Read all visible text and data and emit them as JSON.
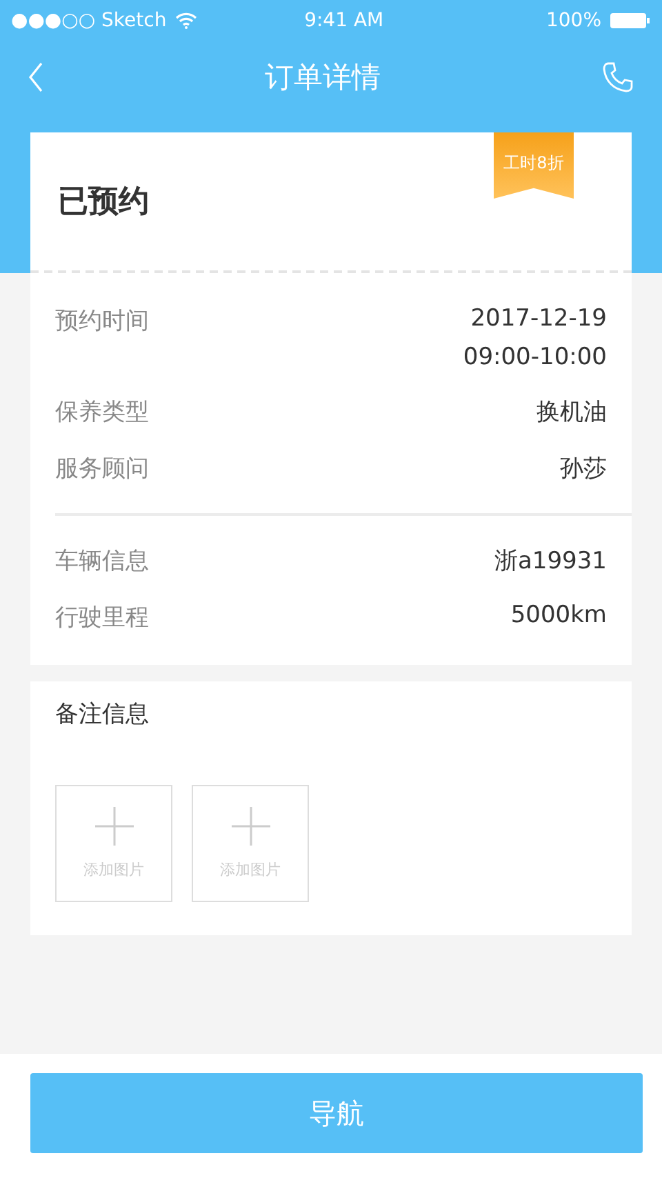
{
  "status_bar": {
    "carrier": "●●●○○ Sketch",
    "time": "9:41 AM",
    "battery": "100%"
  },
  "nav": {
    "title": "订单详情"
  },
  "order": {
    "status": "已预约",
    "ribbon": "工时8折"
  },
  "details": [
    {
      "label": "预约时间",
      "value_lines": [
        "2017-12-19",
        "09:00-10:00"
      ]
    },
    {
      "label": "保养类型",
      "value_lines": [
        "换机油"
      ]
    },
    {
      "label": "服务顾问",
      "value_lines": [
        "孙莎"
      ]
    }
  ],
  "vehicle": [
    {
      "label": "车辆信息",
      "value_lines": [
        "浙a19931"
      ]
    },
    {
      "label": "行驶里程",
      "value_lines": [
        "5000km"
      ]
    }
  ],
  "notes": {
    "title": "备注信息",
    "photo_slots": [
      {
        "label": "添加图片"
      },
      {
        "label": "添加图片"
      }
    ]
  },
  "footer_button": "导航"
}
